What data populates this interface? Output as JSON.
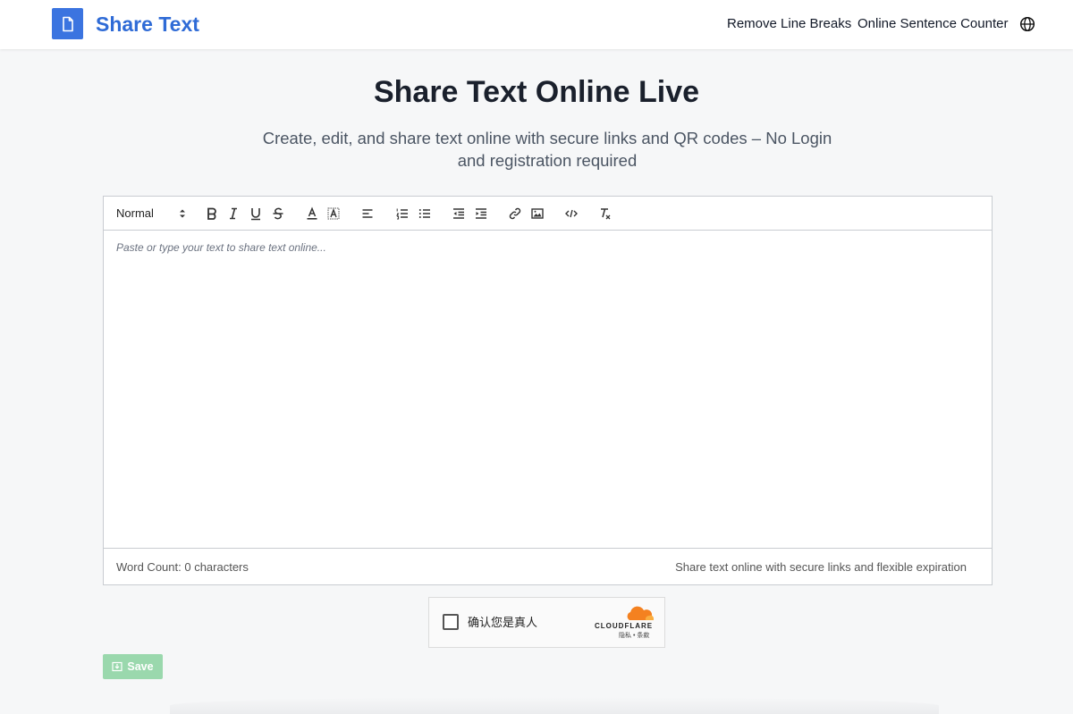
{
  "header": {
    "brand": "Share Text",
    "logo_icon": "document-icon",
    "nav_links": [
      "Remove Line Breaks",
      "Online Sentence Counter"
    ],
    "language_icon": "globe-icon",
    "brand_color": "#2f6bd6"
  },
  "hero": {
    "title": "Share Text Online Live",
    "subtitle": "Create, edit, and share text online with secure links and QR codes – No Login and registration required"
  },
  "editor": {
    "toolbar": {
      "heading_select": "Normal",
      "buttons": [
        "bold",
        "italic",
        "underline",
        "strikethrough",
        "text-color",
        "background-color",
        "align",
        "ordered-list",
        "bullet-list",
        "outdent",
        "indent",
        "link",
        "image",
        "code",
        "clean-format"
      ]
    },
    "placeholder": "Paste or type your text to share text online...",
    "word_count": "Word Count: 0 characters",
    "footer_note": "Share text online with secure links and flexible expiration"
  },
  "captcha": {
    "label": "确认您是真人",
    "brand": "CLOUDFLARE",
    "privacy": "隐私",
    "separator": "•",
    "terms": "条款",
    "checked": false
  },
  "actions": {
    "save_label": "Save",
    "save_color": "#9ad8ad"
  }
}
